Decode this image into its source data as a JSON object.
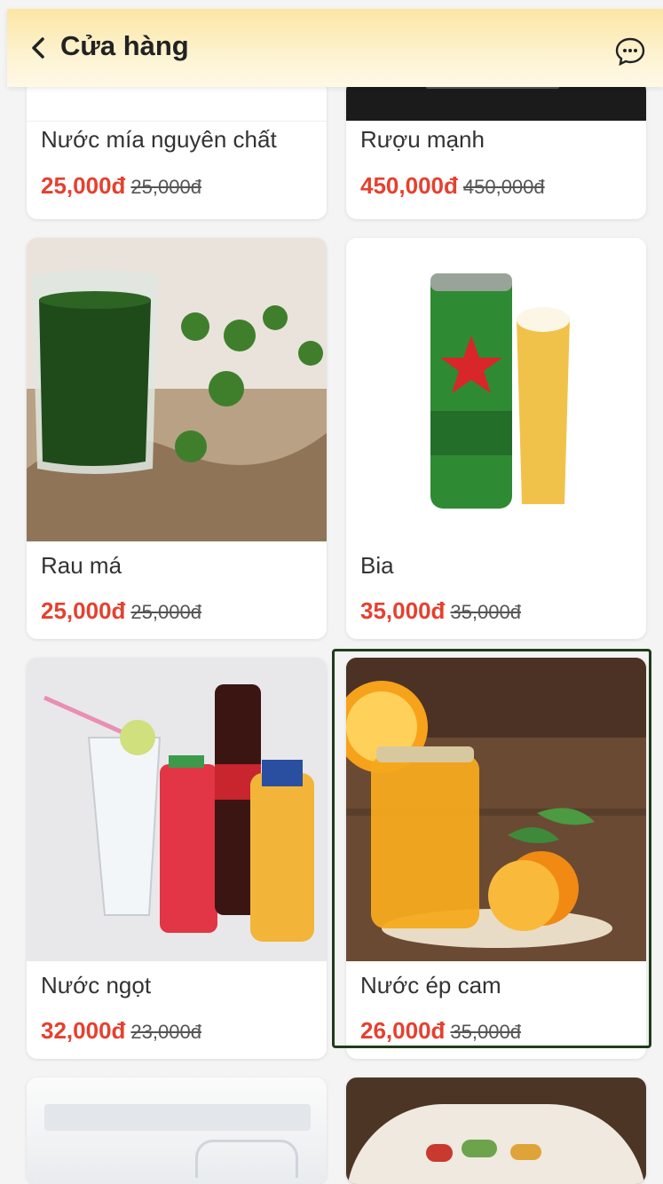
{
  "header": {
    "title": "Cửa hàng",
    "back_icon": "chevron-left-icon",
    "chat_icon": "chat-bubble-icon"
  },
  "colors": {
    "price": "#e6402f",
    "header_gradient_top": "#fbe6a3",
    "selected_border": "#1f3d1a"
  },
  "products": [
    {
      "name": "Nước mía nguyên chất",
      "price": "25,000đ",
      "old_price": "25,000đ"
    },
    {
      "name": "Rượu mạnh",
      "price": "450,000đ",
      "old_price": "450,000đ"
    },
    {
      "name": "Rau má",
      "price": "25,000đ",
      "old_price": "25,000đ"
    },
    {
      "name": "Bia",
      "price": "35,000đ",
      "old_price": "35,000đ"
    },
    {
      "name": "Nước ngọt",
      "price": "32,000đ",
      "old_price": "23,000đ"
    },
    {
      "name": "Nước ép cam",
      "price": "26,000đ",
      "old_price": "35,000đ",
      "selected": true
    }
  ]
}
